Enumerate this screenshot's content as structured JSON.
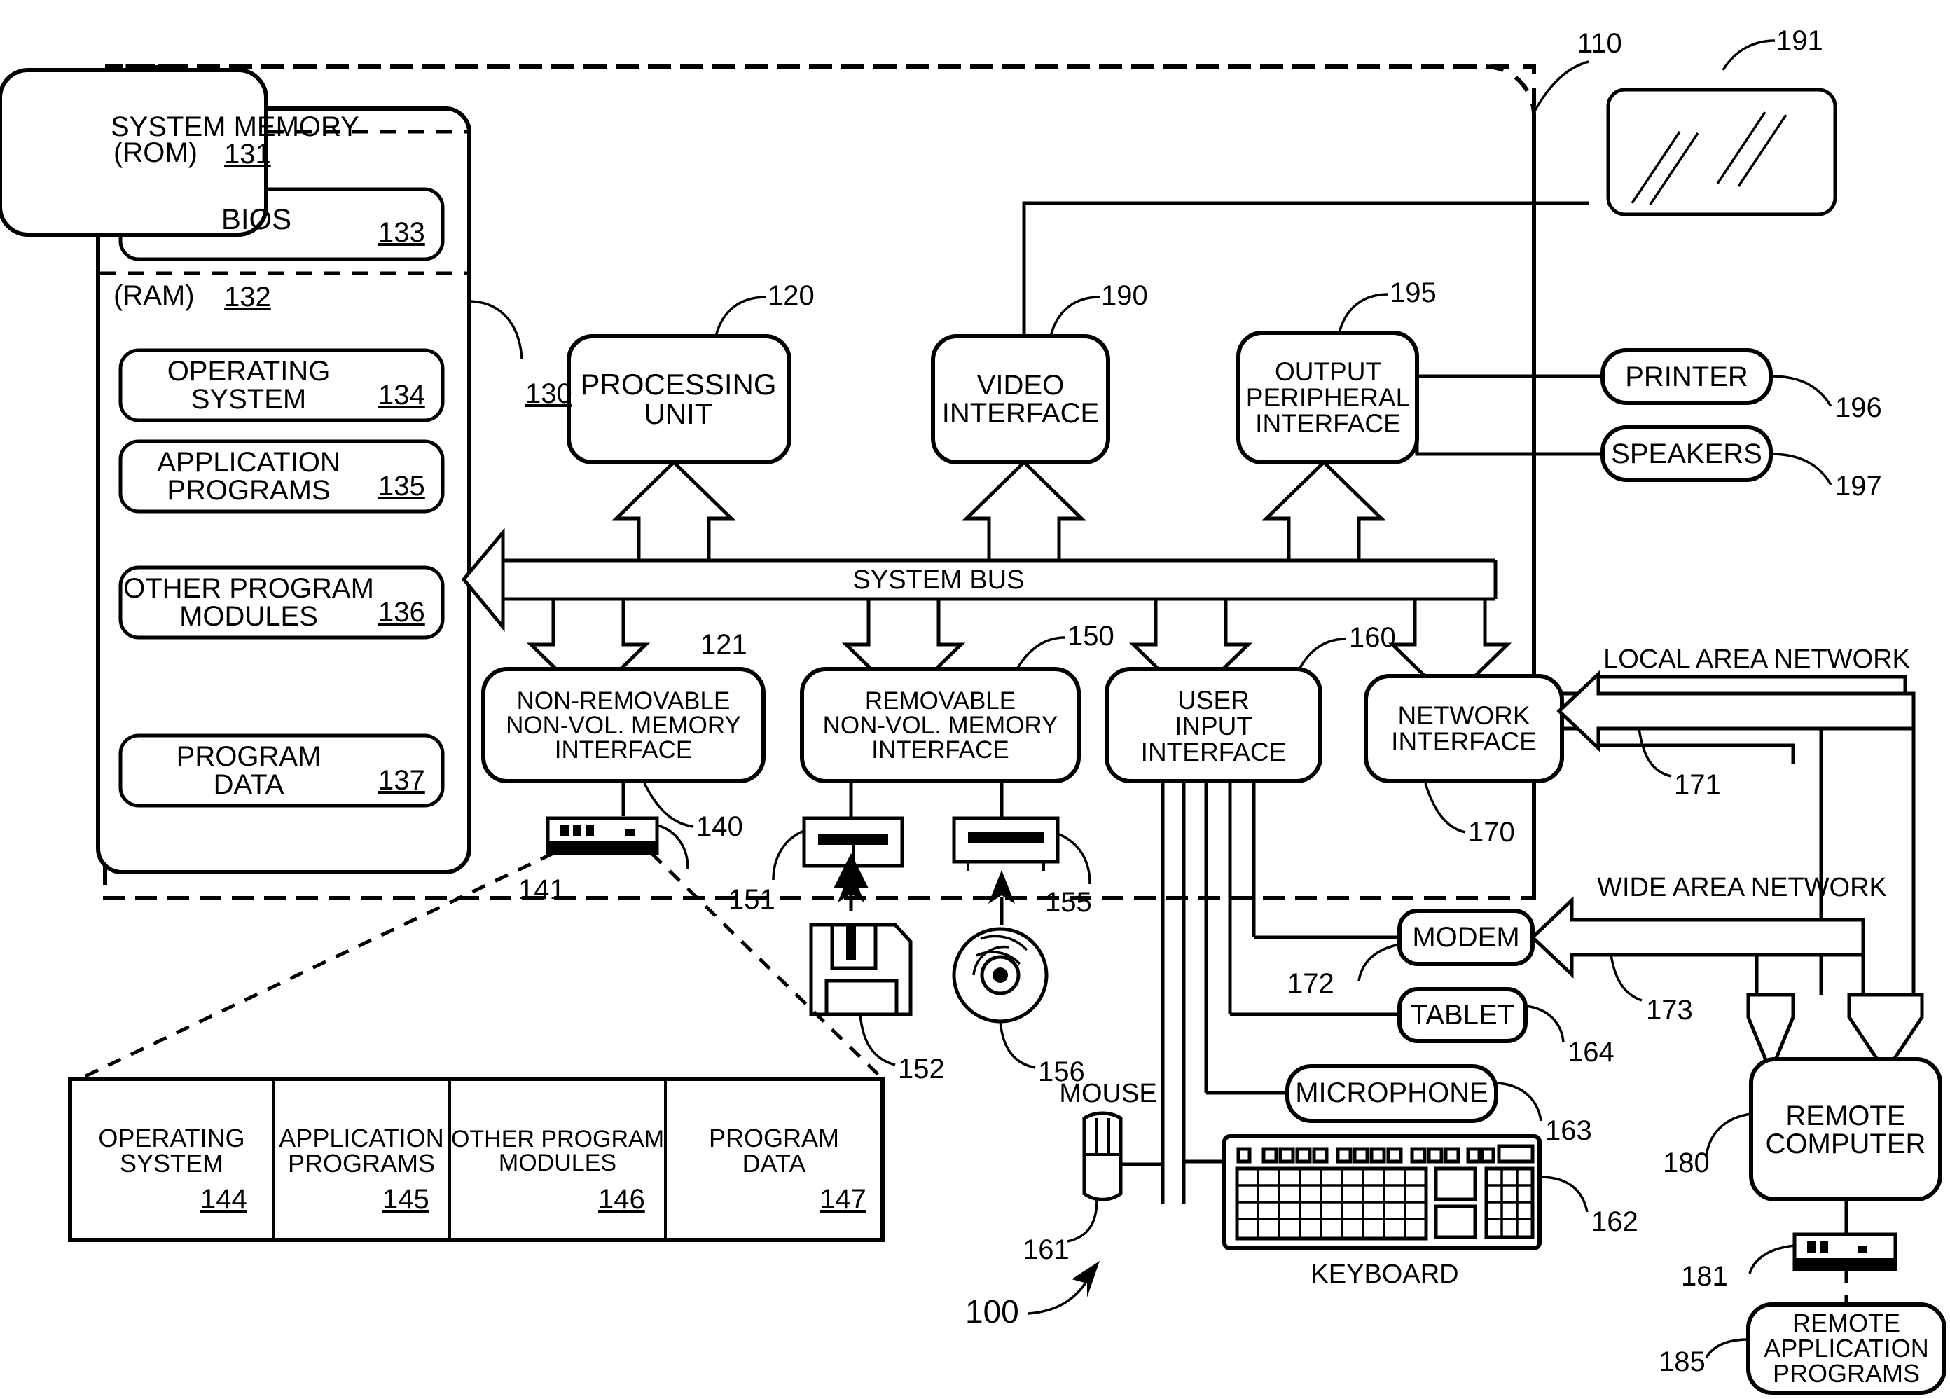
{
  "figure": {
    "system_ref": "100",
    "computer_ref": "110",
    "system_memory_title": "SYSTEM MEMORY",
    "system_memory_ref": "130",
    "rom_label": "(ROM)",
    "rom_ref": "131",
    "ram_label": "(RAM)",
    "ram_ref": "132",
    "system_bus_label": "SYSTEM BUS",
    "system_bus_ref": "121",
    "keyboard_caption": "KEYBOARD",
    "mouse_caption": "MOUSE",
    "lan_label": "LOCAL AREA NETWORK",
    "lan_ref": "171",
    "wan_label": "WIDE AREA NETWORK",
    "wan_ref": "173"
  },
  "memory_blocks": [
    {
      "label": "BIOS",
      "ref": "133"
    },
    {
      "label": "OPERATING\nSYSTEM",
      "ref": "134"
    },
    {
      "label": "APPLICATION\nPROGRAMS",
      "ref": "135"
    },
    {
      "label": "OTHER PROGRAM\nMODULES",
      "ref": "136"
    },
    {
      "label": "PROGRAM\nDATA",
      "ref": "137"
    }
  ],
  "core_blocks": [
    {
      "label": "PROCESSING\nUNIT",
      "ref": "120"
    },
    {
      "label": "VIDEO\nINTERFACE",
      "ref": "190"
    },
    {
      "label": "OUTPUT\nPERIPHERAL\nINTERFACE",
      "ref": "195"
    }
  ],
  "interface_blocks": [
    {
      "label": "NON-REMOVABLE\nNON-VOL. MEMORY\nINTERFACE",
      "ref": "140"
    },
    {
      "label": "REMOVABLE\nNON-VOL. MEMORY\nINTERFACE",
      "ref": "150"
    },
    {
      "label": "USER\nINPUT\nINTERFACE",
      "ref": "160"
    },
    {
      "label": "NETWORK\nINTERFACE",
      "ref": "170"
    }
  ],
  "output_devices": [
    {
      "label": "PRINTER",
      "ref": "196"
    },
    {
      "label": "SPEAKERS",
      "ref": "197"
    }
  ],
  "monitor": {
    "ref": "191"
  },
  "drives": [
    {
      "name": "hard-disk-drive",
      "ref": "141"
    },
    {
      "name": "floppy-disk-drive",
      "ref": "151"
    },
    {
      "name": "floppy-disk-media",
      "ref": "152"
    },
    {
      "name": "optical-disk-drive",
      "ref": "155"
    },
    {
      "name": "optical-disk-media",
      "ref": "156"
    }
  ],
  "input_devices": [
    {
      "label": "MOUSE",
      "ref": "161"
    },
    {
      "label": "KEYBOARD",
      "ref": "162"
    },
    {
      "label": "MICROPHONE",
      "ref": "163"
    },
    {
      "label": "TABLET",
      "ref": "164"
    }
  ],
  "network_devices": [
    {
      "label": "MODEM",
      "ref": "172"
    },
    {
      "label": "REMOTE\nCOMPUTER",
      "ref": "180"
    },
    {
      "label": "REMOTE\nAPPLICATION\nPROGRAMS",
      "ref": "185"
    }
  ],
  "remote_storage_ref": "181",
  "storage_table": {
    "cells": [
      {
        "label": "OPERATING\nSYSTEM",
        "ref": "144"
      },
      {
        "label": "APPLICATION\nPROGRAMS",
        "ref": "145"
      },
      {
        "label": "OTHER PROGRAM\nMODULES",
        "ref": "146"
      },
      {
        "label": "PROGRAM\nDATA",
        "ref": "147"
      }
    ]
  }
}
